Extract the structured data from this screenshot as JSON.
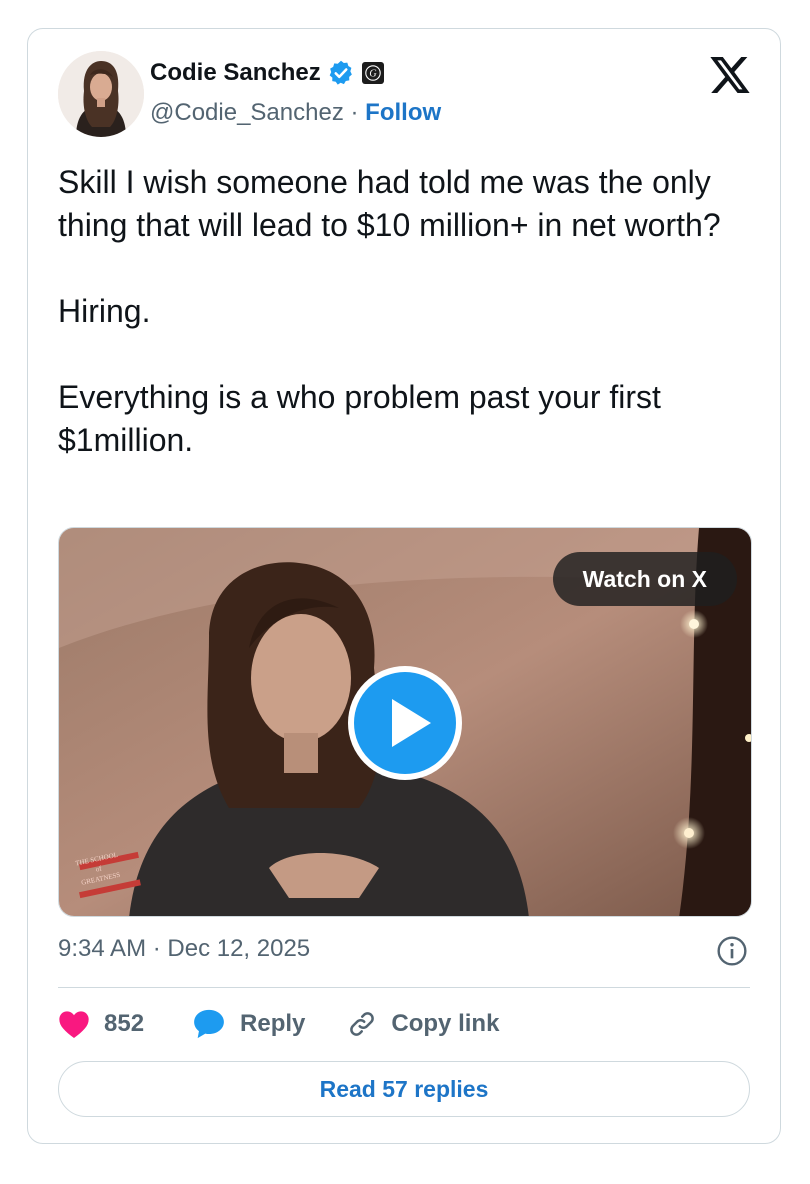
{
  "author": {
    "name": "Codie Sanchez",
    "handle": "@Codie_Sanchez",
    "separator": "·",
    "follow_label": "Follow"
  },
  "tweet": {
    "paragraphs": [
      "Skill I wish someone had told me was the only thing that will lead to $10 million+ in net worth?",
      "Hiring.",
      "Everything is a who problem past your first $1million."
    ]
  },
  "media": {
    "watch_label": "Watch on X",
    "watermark_lines": [
      "THE SCHOOL",
      "of",
      "GREATNESS"
    ]
  },
  "meta": {
    "time": "9:34 AM · Dec 12, 2025"
  },
  "actions": {
    "like_count": "852",
    "reply_label": "Reply",
    "copy_label": "Copy link"
  },
  "read_replies_label": "Read 57 replies",
  "colors": {
    "link": "#1d75c7",
    "like": "#f91880",
    "reply": "#1d9bf0",
    "secondary_text": "#536471",
    "border": "#cfd9de"
  }
}
